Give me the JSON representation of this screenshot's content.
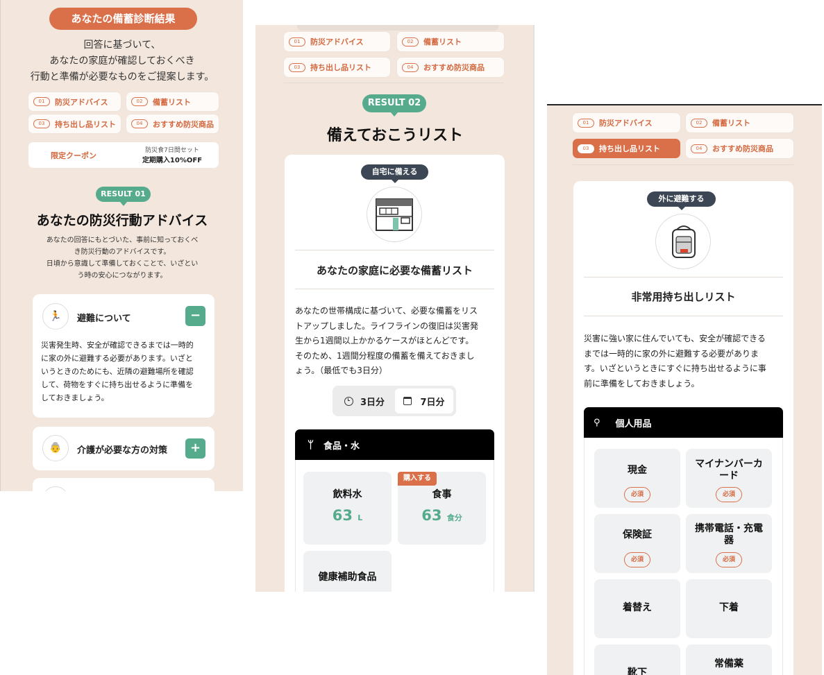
{
  "panel1": {
    "title": "あなたの備蓄診断結果",
    "intro_lines": [
      "回答に基づいて、",
      "あなたの家庭が確認しておくべき",
      "行動と準備が必要なものをご提案します。"
    ],
    "nav": [
      {
        "num": "01",
        "label": "防災アドバイス"
      },
      {
        "num": "02",
        "label": "備蓄リスト"
      },
      {
        "num": "03",
        "label": "持ち出し品リスト"
      },
      {
        "num": "04",
        "label": "おすすめ防災商品"
      }
    ],
    "coupon": {
      "label": "限定クーポン",
      "sub": "防災食7日間セット",
      "offer": "定期購入10%OFF"
    },
    "result_badge": "RESULT 01",
    "heading": "あなたの防災行動アドバイス",
    "desc_lines": [
      "あなたの回答にもとづいた、事前に知っておくべ",
      "き防災行動のアドバイスです。",
      "日頃から意識して準備しておくことで、いざとい",
      "う時の安心につながります。"
    ],
    "accordion": [
      {
        "icon": "running-person-icon",
        "title": "避難について",
        "toggle": "−",
        "body_lines": [
          "災害発生時、安全が確認できるまでは一時的",
          "に家の外に避難する必要があります。いざと",
          "いうときのためにも、近隣の避難場所を確認",
          "して、荷物をすぐに持ち出せるように準備を",
          "しておきましょう。"
        ]
      },
      {
        "icon": "elderly-person-icon",
        "title": "介護が必要な方の対策",
        "toggle": "+"
      }
    ]
  },
  "panel2": {
    "nav": [
      {
        "num": "01",
        "label": "防災アドバイス"
      },
      {
        "num": "02",
        "label": "備蓄リスト"
      },
      {
        "num": "03",
        "label": "持ち出し品リスト"
      },
      {
        "num": "04",
        "label": "おすすめ防災商品"
      }
    ],
    "result_badge": "RESULT 02",
    "heading": "備えておこうリスト",
    "card_badge": "自宅に備える",
    "card_title": "あなたの家庭に必要な備蓄リスト",
    "desc_lines": [
      "あなたの世帯構成に基づいて、必要な備蓄をリス",
      "トアップしました。ライフラインの復旧は災害発",
      "生から1週間以上かかるケースがほとんどです。",
      "そのため、1週間分程度の備蓄を備えておきまし",
      "ょう。（最低でも3日分）"
    ],
    "toggle": {
      "opt1": "3日分",
      "opt2": "7日分",
      "selected": "7日分"
    },
    "category": "食品・水",
    "items": [
      {
        "name": "飲料水",
        "value": "63",
        "unit": "L"
      },
      {
        "name": "食事",
        "value": "63",
        "unit": "食分",
        "tag": "購入する"
      },
      {
        "name": "健康補助食品"
      }
    ]
  },
  "panel3": {
    "nav": [
      {
        "num": "01",
        "label": "防災アドバイス"
      },
      {
        "num": "02",
        "label": "備蓄リスト"
      },
      {
        "num": "03",
        "label": "持ち出し品リスト"
      },
      {
        "num": "04",
        "label": "おすすめ防災商品"
      }
    ],
    "active_nav": "03",
    "card_badge": "外に避難する",
    "card_title": "非常用持ち出しリスト",
    "desc_lines": [
      "災害に強い家に住んでいても、安全が確認できる",
      "までは一時的に家の外に避難する必要がありま",
      "す。いざというときにすぐに持ち出せるように事",
      "前に準備をしておきましょう。"
    ],
    "category": "個人用品",
    "items": [
      {
        "name": "現金",
        "badge": "必須"
      },
      {
        "name_lines": [
          "マイナンバーカ",
          "ード"
        ],
        "badge": "必須"
      },
      {
        "name": "保険証",
        "badge": "必須"
      },
      {
        "name_lines": [
          "携帯電話・充電",
          "器"
        ],
        "badge": "必須"
      },
      {
        "name": "着替え"
      },
      {
        "name": "下着"
      },
      {
        "name": "靴下"
      },
      {
        "name": "常備薬"
      }
    ]
  }
}
